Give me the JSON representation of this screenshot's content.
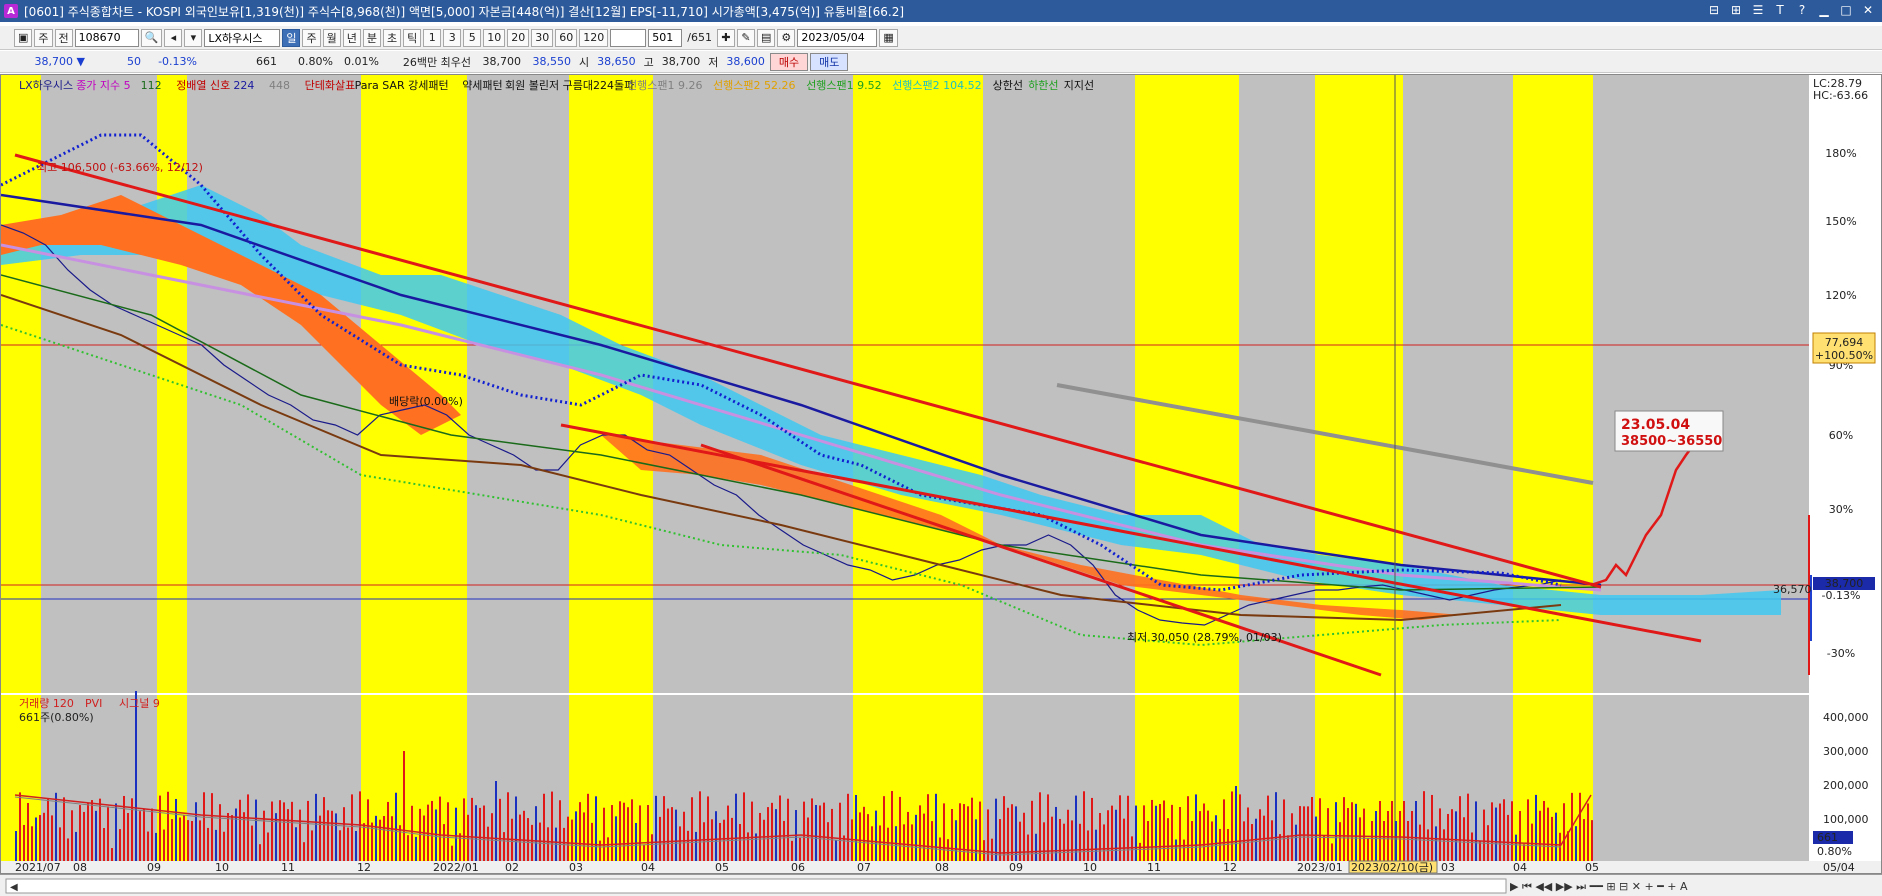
{
  "window": {
    "title": "[0601] 주식종합차트 - KOSPI 외국인보유[1,319(천)] 주식수[8,968(천)] 액면[5,000] 자본금[448(억)] 결산[12월] EPS[-11,710] 시가총액[3,475(억)] 유통비율[66.2]",
    "icon": "A"
  },
  "toolbar": {
    "stock_code": "108670",
    "mode_label": "주",
    "prev_label": "전",
    "stock_name": "LX하우시스",
    "periods": [
      "일",
      "주",
      "월",
      "년",
      "분",
      "초",
      "틱"
    ],
    "active_period": "일",
    "intervals": [
      "1",
      "3",
      "5",
      "10",
      "20",
      "30",
      "60",
      "120"
    ],
    "count": "501",
    "total": "/651",
    "date": "2023/05/04"
  },
  "quote": {
    "price": "38,700 ▼",
    "change": "50",
    "change_pct": "-0.13%",
    "volume": "661",
    "vol_pct": "0.80%",
    "turnover": "0.01%",
    "low52_label": "26백만 최우선",
    "best1": "38,700",
    "best2": "38,550",
    "open_label": "시",
    "open": "38,650",
    "high_label": "고",
    "high": "38,700",
    "low_label": "저",
    "low": "38,600",
    "buy_label": "매수",
    "sell_label": "매도"
  },
  "legend": [
    {
      "text": "LX하우시스",
      "color": "#1a1a8a"
    },
    {
      "text": "종가 지수 5",
      "color": "#c000c0"
    },
    {
      "text": "112",
      "color": "#1a6a1a"
    },
    {
      "text": "정배열 신호",
      "color": "#c00000"
    },
    {
      "text": "224",
      "color": "#1a1aa0"
    },
    {
      "text": "448",
      "color": "#808080"
    },
    {
      "text": "단테화살표",
      "color": "#c00000"
    },
    {
      "text": "Para SAR 강세패턴",
      "color": "#111111"
    },
    {
      "text": "약세패턴",
      "color": "#111111"
    },
    {
      "text": "회원 볼린저 구름대224돌파",
      "color": "#111111"
    },
    {
      "text": "선행스팬1 9.26",
      "color": "#808080"
    },
    {
      "text": "선행스팬2 52.26",
      "color": "#e0a000"
    },
    {
      "text": "선행스팬1 9.52",
      "color": "#20a020"
    },
    {
      "text": "선행스팬2 104.52",
      "color": "#20c0c0"
    },
    {
      "text": "상한선",
      "color": "#111111"
    },
    {
      "text": "하한선",
      "color": "#20a020"
    },
    {
      "text": "지지선",
      "color": "#111111"
    }
  ],
  "price_axis": {
    "labels": [
      "180%",
      "150%",
      "120%",
      "90%",
      "60%",
      "30%",
      "-0.13%",
      "-30%"
    ],
    "lc": "LC:28.79",
    "hc": "HC:-63.66",
    "marker_top": "77,694",
    "marker_top_pct": "+100.50%",
    "current": "38,700",
    "support": "36,570"
  },
  "annotations": {
    "high_label": "최고 106,500 (-63.66%, 12/12)",
    "low_label": "최저 30,050 (28.79%, 01/03)",
    "dividend": "배당락(0.00%)",
    "target_date": "23.05.04",
    "target_range": "38500~36550"
  },
  "volume_panel": {
    "legend": [
      "거래량 120",
      "PVI",
      "시그널 9"
    ],
    "current_label": "661주(0.80%)",
    "axis_labels": [
      "400,000",
      "300,000",
      "200,000",
      "100,000"
    ],
    "current_value": "661",
    "current_pct": "0.80%"
  },
  "time_axis": {
    "labels": [
      "2021/07",
      "08",
      "09",
      "10",
      "11",
      "12",
      "2022/01",
      "02",
      "03",
      "04",
      "05",
      "06",
      "07",
      "08",
      "09",
      "10",
      "11",
      "12",
      "2023/01",
      "2023/02/10(금)",
      "03",
      "04",
      "05"
    ],
    "right_label": "05/04"
  }
}
